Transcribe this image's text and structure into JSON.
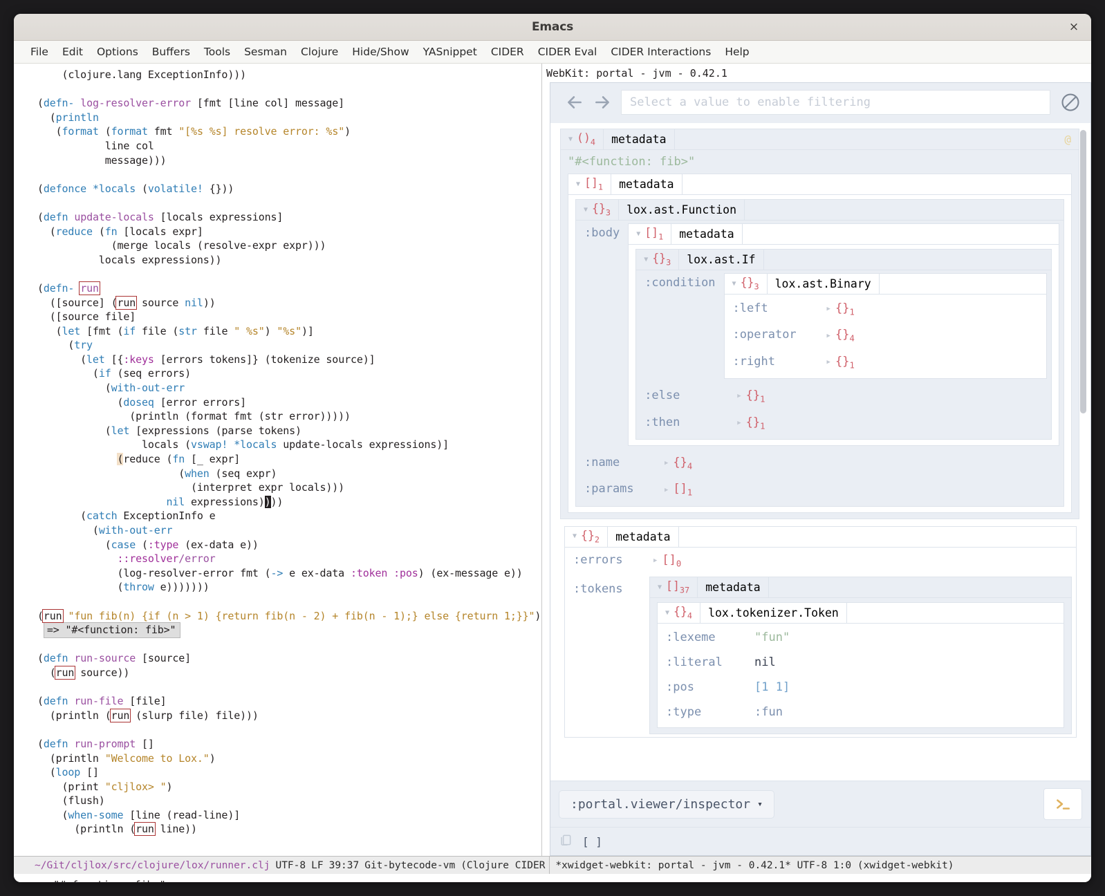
{
  "window": {
    "title": "Emacs",
    "close_label": "×"
  },
  "menubar": {
    "items": [
      {
        "label": "File"
      },
      {
        "label": "Edit"
      },
      {
        "label": "Options"
      },
      {
        "label": "Buffers"
      },
      {
        "label": "Tools"
      },
      {
        "label": "Sesman"
      },
      {
        "label": "Clojure"
      },
      {
        "label": "Hide/Show"
      },
      {
        "label": "YASnippet"
      },
      {
        "label": "CIDER"
      },
      {
        "label": "CIDER Eval"
      },
      {
        "label": "CIDER Interactions"
      },
      {
        "label": "Help"
      }
    ]
  },
  "editor": {
    "modeline": {
      "path": "~/Git/cljlox/src/clojure/lox/runner.clj",
      "encoding": "UTF-8",
      "eol": "LF",
      "position": "39:37",
      "vc": "Git-bytecode-vm",
      "major_mode": "(Clojure CIDER"
    },
    "echo_area": "=> \"#<function: fib>\"",
    "eval_overlay": "=> \"#<function: fib>\"",
    "highlighted_symbol": "run"
  },
  "portal": {
    "buffer_label": "WebKit: portal - jvm - 0.42.1",
    "toolbar": {
      "back_icon": "arrow-left-icon",
      "forward_icon": "arrow-right-icon",
      "filter_placeholder": "Select a value to enable filtering",
      "filter_value": "",
      "clear_icon": "ban-icon"
    },
    "root": {
      "coll": "()",
      "count": "4",
      "meta_label": "metadata",
      "at_glyph": "@",
      "value_string": "\"#<function: fib>\""
    },
    "vector_node": {
      "coll": "[]",
      "count": "1",
      "meta_label": "metadata"
    },
    "function_node": {
      "coll": "{}",
      "count": "3",
      "type_name": "lox.ast.Function",
      "body_key": ":body",
      "body_coll": "[]",
      "body_count": "1",
      "body_meta": "metadata",
      "if_coll": "{}",
      "if_count": "3",
      "if_type": "lox.ast.If",
      "condition_key": ":condition",
      "binary_coll": "{}",
      "binary_count": "3",
      "binary_type": "lox.ast.Binary",
      "binary_rows": [
        {
          "key": ":left",
          "coll": "{}",
          "count": "1"
        },
        {
          "key": ":operator",
          "coll": "{}",
          "count": "4"
        },
        {
          "key": ":right",
          "coll": "{}",
          "count": "1"
        }
      ],
      "if_rows": [
        {
          "key": ":else",
          "coll": "{}",
          "count": "1"
        },
        {
          "key": ":then",
          "coll": "{}",
          "count": "1"
        }
      ],
      "fn_rows": [
        {
          "key": ":name",
          "coll": "{}",
          "count": "4"
        },
        {
          "key": ":params",
          "coll": "[]",
          "count": "1"
        }
      ]
    },
    "tokens_node": {
      "coll": "{}",
      "count": "2",
      "meta_label": "metadata",
      "errors_key": ":errors",
      "errors_coll": "[]",
      "errors_count": "0",
      "tokens_key": ":tokens",
      "tokens_coll": "[]",
      "tokens_count": "37",
      "tokens_meta": "metadata",
      "token_coll": "{}",
      "token_count": "4",
      "token_type": "lox.tokenizer.Token",
      "token_rows": [
        {
          "key": ":lexeme",
          "value": "\"fun\"",
          "kind": "string"
        },
        {
          "key": ":literal",
          "value": "nil",
          "kind": "nil"
        },
        {
          "key": ":pos",
          "value": "[1 1]",
          "kind": "vector"
        },
        {
          "key": ":type",
          "value": ":fun",
          "kind": "keyword"
        }
      ]
    },
    "bottom": {
      "viewer_label": ":portal.viewer/inspector",
      "viewer_caret": "▾",
      "terminal_icon": "terminal-icon",
      "copy_icon": "copy-icon",
      "status_value": "[ ]"
    },
    "modeline": "*xwidget-webkit: portal - jvm - 0.42.1* UTF-8 1:0 (xwidget-webkit)"
  },
  "colors": {
    "keyword_blue": "#2f7db5",
    "fn_purple": "#9a4fa0",
    "string_gold": "#b5852a",
    "clj_keyword": "#a0309a",
    "portal_bg": "#eaeef4",
    "portal_red": "#d0606a",
    "portal_key": "#7b8fae",
    "portal_string": "#9cb99c"
  }
}
